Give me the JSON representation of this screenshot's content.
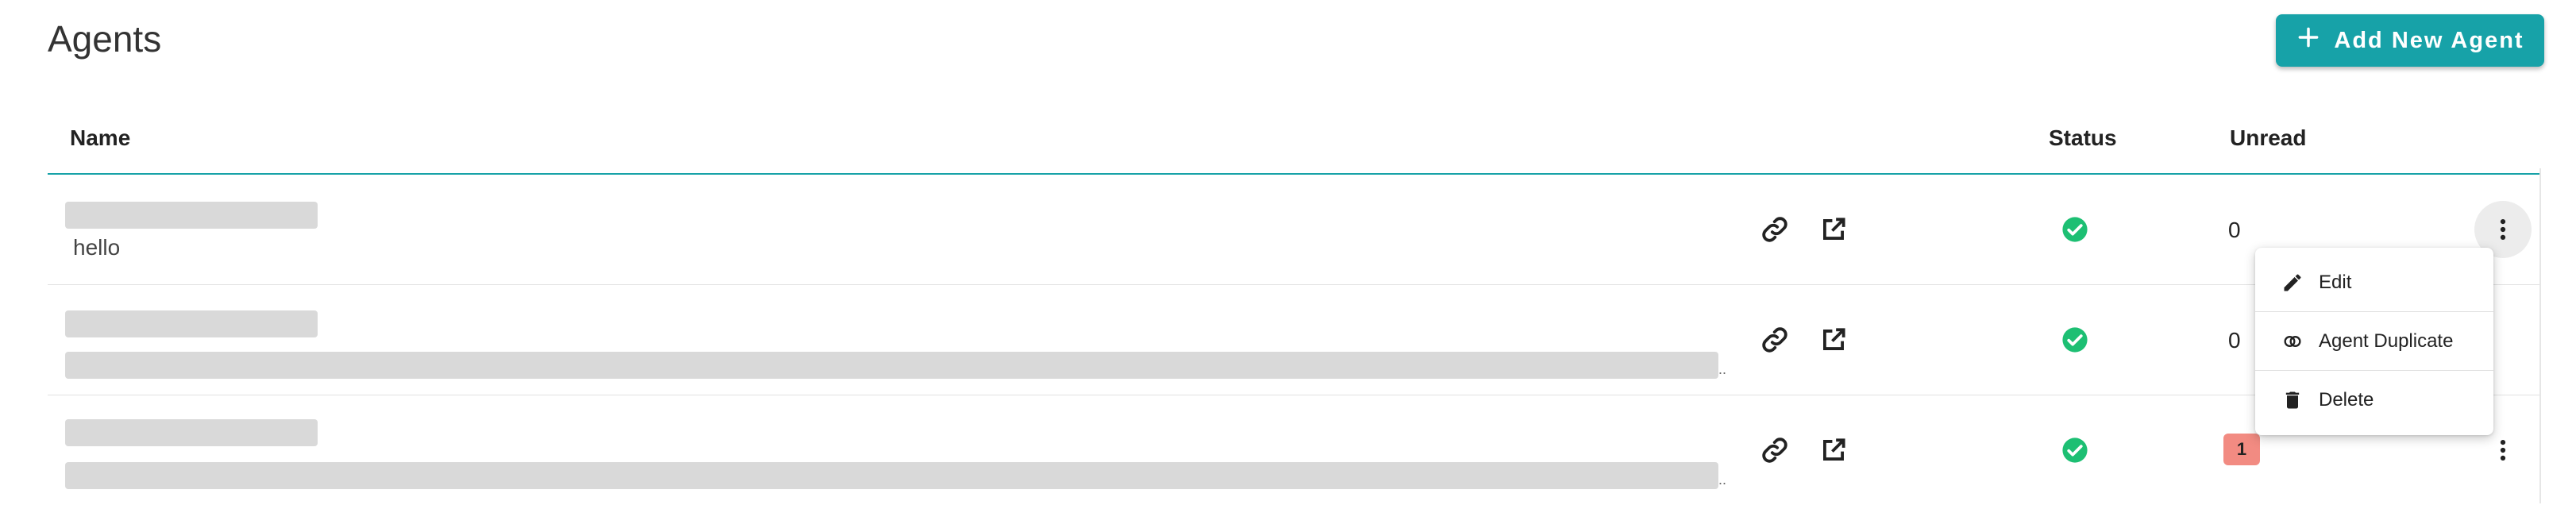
{
  "page": {
    "title": "Agents"
  },
  "header": {
    "add_button_label": "Add New Agent"
  },
  "table": {
    "columns": {
      "name": "Name",
      "status": "Status",
      "unread": "Unread"
    },
    "rows": [
      {
        "description": "hello",
        "status": "active",
        "unread": "0",
        "unread_style": "plain"
      },
      {
        "description": "",
        "ellipsis": "..",
        "status": "active",
        "unread": "0",
        "unread_style": "plain"
      },
      {
        "description": "",
        "ellipsis": "..",
        "status": "active",
        "unread": "1",
        "unread_style": "badge"
      }
    ]
  },
  "context_menu": {
    "items": [
      {
        "label": "Edit",
        "icon": "pencil-icon"
      },
      {
        "label": "Agent Duplicate",
        "icon": "duplicate-icon"
      },
      {
        "label": "Delete",
        "icon": "trash-icon"
      }
    ]
  },
  "colors": {
    "accent": "#17a2a8",
    "status_ok": "#1dbf73",
    "badge": "#f28b82"
  }
}
